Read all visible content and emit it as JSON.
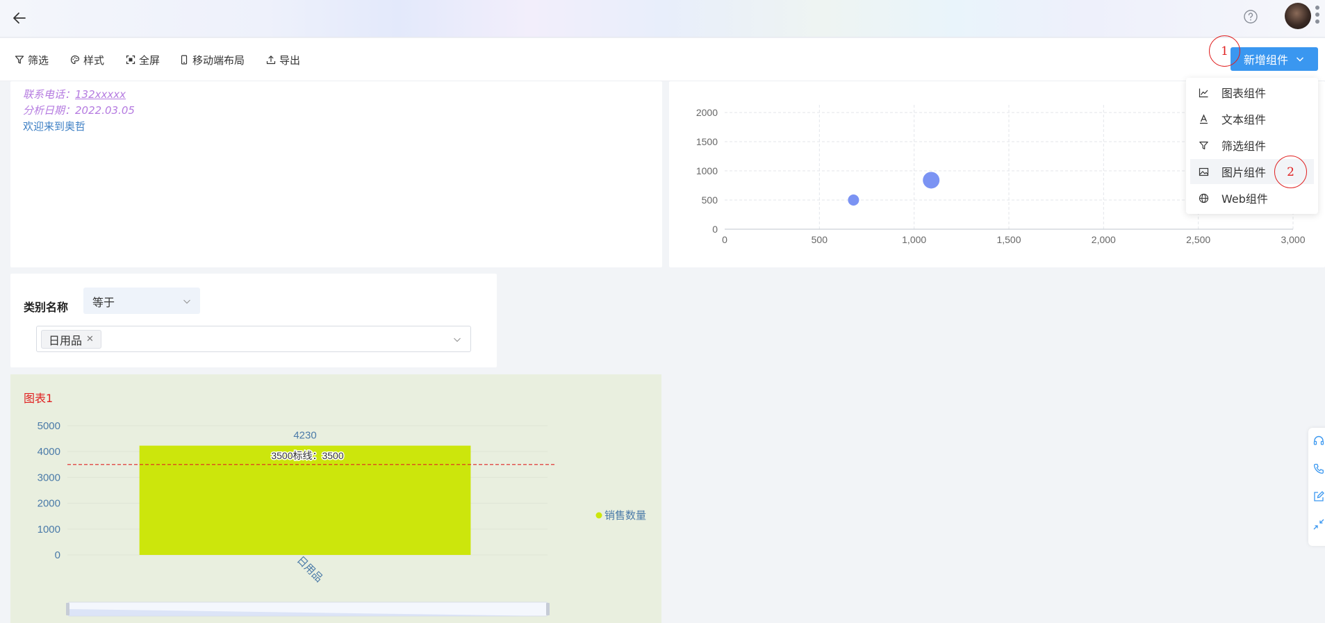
{
  "toolbar": {
    "filter": "筛选",
    "style": "样式",
    "fullscreen": "全屏",
    "mobile_layout": "移动端布局",
    "export": "导出",
    "add_component": "新增组件"
  },
  "annotations": {
    "one": "1",
    "two": "2"
  },
  "menu": {
    "items": [
      "图表组件",
      "文本组件",
      "筛选组件",
      "图片组件",
      "Web组件"
    ],
    "hovered_index": 3
  },
  "info": {
    "phone_label": "联系电话：",
    "phone_value": "132xxxxx",
    "date_label": "分析日期：",
    "date_value": "2022.03.05",
    "welcome": "欢迎来到奥哲"
  },
  "filter": {
    "label": "类别名称",
    "operator": "等于",
    "tag": "日用品"
  },
  "colors": {
    "accent": "#3a97f0",
    "scatter_point": "#7b93f3",
    "bar": "#cce60c",
    "markline": "#e02020",
    "italic_text": "#b57be0"
  },
  "chart_data": [
    {
      "type": "scatter",
      "x_ticks": [
        "0",
        "500",
        "1,000",
        "1,500",
        "2,000",
        "2,500",
        "3,000"
      ],
      "y_ticks": [
        "0",
        "500",
        "1000",
        "1500",
        "2000"
      ],
      "xlim": [
        0,
        3000
      ],
      "ylim": [
        0,
        2000
      ],
      "points": [
        {
          "x": 680,
          "y": 500,
          "size": 1
        },
        {
          "x": 1090,
          "y": 840,
          "size": 1.5
        }
      ],
      "grid": true
    },
    {
      "type": "bar",
      "title": "图表1",
      "categories": [
        "日用品"
      ],
      "series": [
        {
          "name": "销售数量",
          "values": [
            4230
          ]
        }
      ],
      "data_labels": [
        "4230"
      ],
      "ylim": [
        0,
        5000
      ],
      "y_ticks": [
        "0",
        "1000",
        "2000",
        "3000",
        "4000",
        "5000"
      ],
      "mark_line": {
        "value": 3500,
        "label": "3500标线：3500"
      },
      "legend": "right",
      "datazoom": [
        0,
        1
      ]
    }
  ]
}
